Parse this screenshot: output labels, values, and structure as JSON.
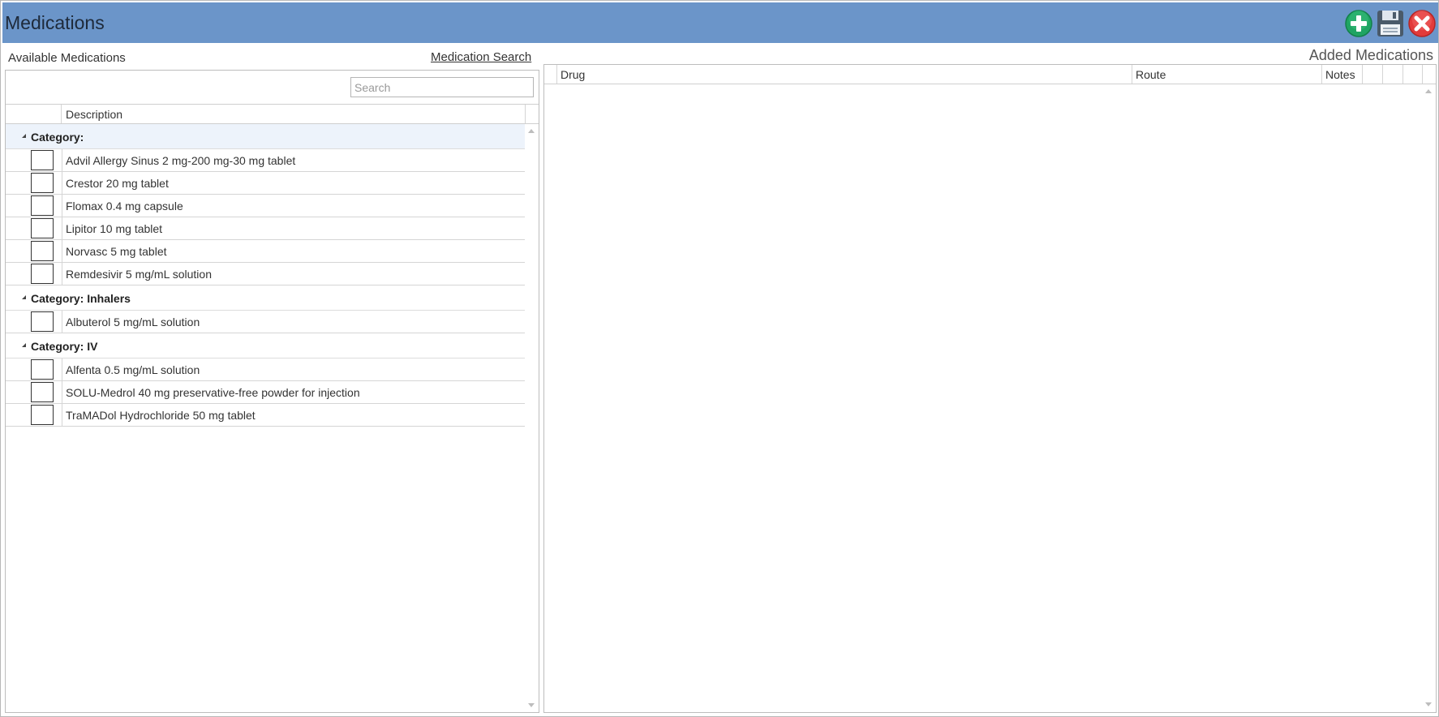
{
  "window": {
    "title": "Medications"
  },
  "toolbar": {
    "add_icon": "add-icon",
    "save_icon": "save-icon",
    "close_icon": "close-icon",
    "colors": {
      "titlebar": "#6b95c9",
      "add": "#1fa463",
      "save": "#4a5a6a",
      "close": "#e23b3b"
    }
  },
  "left": {
    "title": "Available Medications",
    "search_link": "Medication Search",
    "search_placeholder": "Search",
    "search_value": "",
    "columns": {
      "description": "Description"
    },
    "groups": [
      {
        "label": "Category:",
        "items": [
          "Advil Allergy Sinus 2 mg-200 mg-30 mg tablet",
          "Crestor 20 mg tablet",
          "Flomax 0.4 mg capsule",
          "Lipitor 10 mg tablet",
          "Norvasc 5 mg tablet",
          "Remdesivir 5 mg/mL solution"
        ]
      },
      {
        "label": "Category: Inhalers",
        "items": [
          "Albuterol 5 mg/mL solution"
        ]
      },
      {
        "label": "Category: IV",
        "items": [
          "Alfenta 0.5 mg/mL solution",
          "SOLU-Medrol 40 mg preservative-free powder for injection",
          "TraMADol Hydrochloride 50 mg tablet"
        ]
      }
    ]
  },
  "right": {
    "title": "Added Medications",
    "columns": {
      "drug": "Drug",
      "route": "Route",
      "notes": "Notes"
    },
    "rows": []
  }
}
